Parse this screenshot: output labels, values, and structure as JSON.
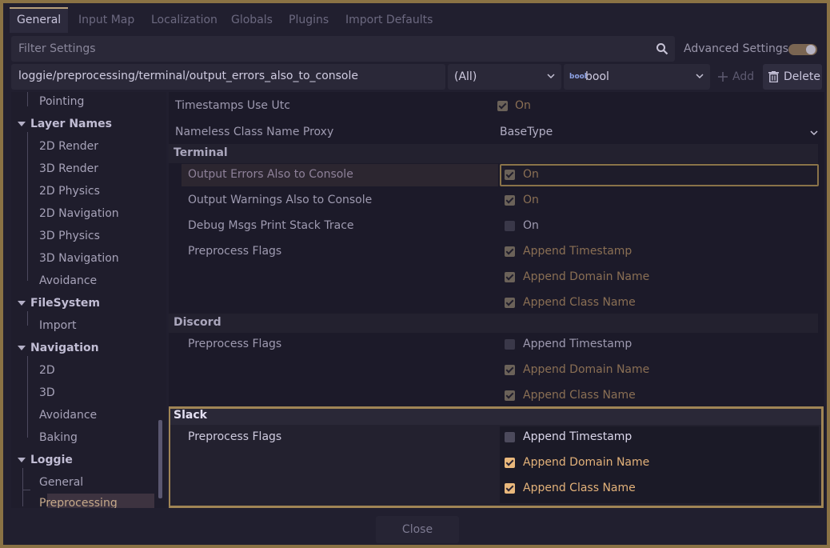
{
  "tabs": [
    "General",
    "Input Map",
    "Localization",
    "Globals",
    "Plugins",
    "Import Defaults"
  ],
  "filter": {
    "placeholder": "Filter Settings"
  },
  "advanced": {
    "label": "Advanced Settings",
    "enabled": true
  },
  "path_bar": {
    "value": "loggie/preprocessing/terminal/output_errors_also_to_console",
    "scope": "(All)",
    "type": "bool",
    "type_badge": "bool",
    "add_label": "Add",
    "delete_label": "Delete"
  },
  "sidebar": {
    "items": [
      {
        "label": "Pointing",
        "kind": "item"
      },
      {
        "label": "Layer Names",
        "kind": "category"
      },
      {
        "label": "2D Render",
        "kind": "item"
      },
      {
        "label": "3D Render",
        "kind": "item"
      },
      {
        "label": "2D Physics",
        "kind": "item"
      },
      {
        "label": "2D Navigation",
        "kind": "item"
      },
      {
        "label": "3D Physics",
        "kind": "item"
      },
      {
        "label": "3D Navigation",
        "kind": "item"
      },
      {
        "label": "Avoidance",
        "kind": "item"
      },
      {
        "label": "FileSystem",
        "kind": "category"
      },
      {
        "label": "Import",
        "kind": "item"
      },
      {
        "label": "Navigation",
        "kind": "category"
      },
      {
        "label": "2D",
        "kind": "item"
      },
      {
        "label": "3D",
        "kind": "item"
      },
      {
        "label": "Avoidance",
        "kind": "item"
      },
      {
        "label": "Baking",
        "kind": "item"
      },
      {
        "label": "Loggie",
        "kind": "category"
      },
      {
        "label": "General",
        "kind": "item"
      },
      {
        "label": "Preprocessing",
        "kind": "item",
        "selected": true
      }
    ]
  },
  "inspector": {
    "timestamps_label": "Timestamps Use Utc",
    "timestamps_value": "On",
    "nameless_label": "Nameless Class Name Proxy",
    "nameless_value": "BaseType",
    "terminal": {
      "title": "Terminal",
      "output_errors_label": "Output Errors Also to Console",
      "output_errors_value": "On",
      "output_warnings_label": "Output Warnings Also to Console",
      "output_warnings_value": "On",
      "debug_label": "Debug Msgs Print Stack Trace",
      "debug_value": "On",
      "flags_label": "Preprocess Flags",
      "flags": [
        "Append Timestamp",
        "Append Domain Name",
        "Append Class Name"
      ]
    },
    "discord": {
      "title": "Discord",
      "flags_label": "Preprocess Flags",
      "flags": [
        "Append Timestamp",
        "Append Domain Name",
        "Append Class Name"
      ]
    },
    "slack": {
      "title": "Slack",
      "flags_label": "Preprocess Flags",
      "flags": [
        "Append Timestamp",
        "Append Domain Name",
        "Append Class Name"
      ]
    }
  },
  "close_label": "Close",
  "colors": {
    "accent": "#e9b87c",
    "frame": "#8a7244",
    "highlight_border": "#a08555"
  }
}
